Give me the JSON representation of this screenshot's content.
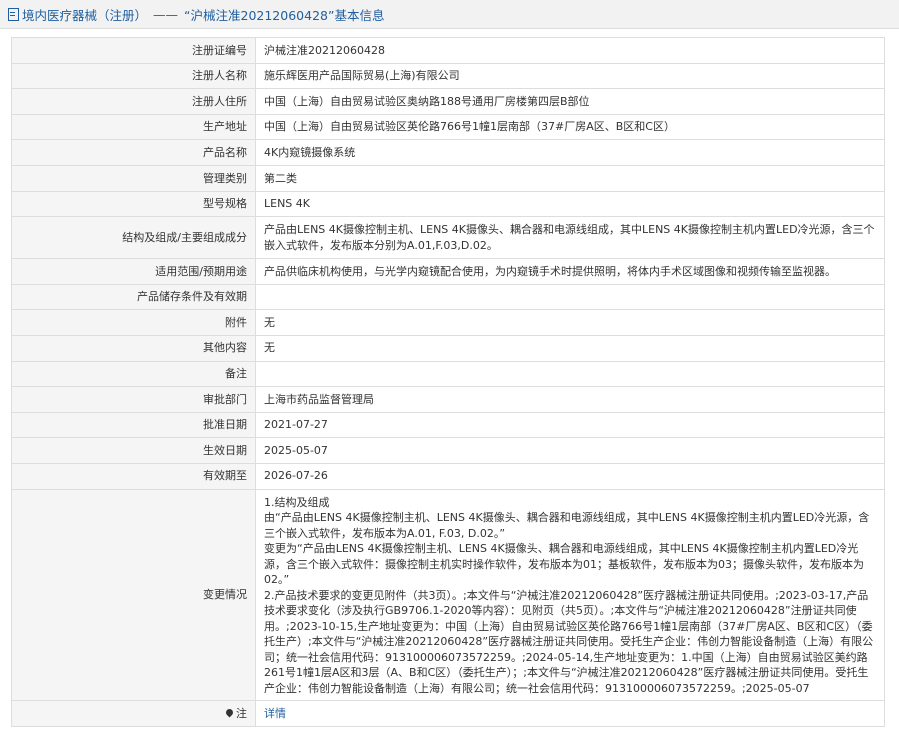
{
  "header": {
    "category": "境内医疗器械（注册）",
    "separator": "——",
    "title": "“沪械注准20212060428”基本信息"
  },
  "rows": [
    {
      "label": "注册证编号",
      "value": "沪械注准20212060428"
    },
    {
      "label": "注册人名称",
      "value": "施乐辉医用产品国际贸易(上海)有限公司"
    },
    {
      "label": "注册人住所",
      "value": "中国（上海）自由贸易试验区奥纳路188号通用厂房楼第四层B部位"
    },
    {
      "label": "生产地址",
      "value": "中国（上海）自由贸易试验区英伦路766号1幢1层南部（37#厂房A区、B区和C区）"
    },
    {
      "label": "产品名称",
      "value": "4K内窥镜摄像系统"
    },
    {
      "label": "管理类别",
      "value": "第二类"
    },
    {
      "label": "型号规格",
      "value": "LENS 4K"
    },
    {
      "label": "结构及组成/主要组成成分",
      "value": "产品由LENS 4K摄像控制主机、LENS 4K摄像头、耦合器和电源线组成，其中LENS 4K摄像控制主机内置LED冷光源，含三个嵌入式软件，发布版本分别为A.01,F.03,D.02。"
    },
    {
      "label": "适用范围/预期用途",
      "value": "产品供临床机构使用，与光学内窥镜配合使用，为内窥镜手术时提供照明，将体内手术区域图像和视频传输至监视器。"
    },
    {
      "label": "产品储存条件及有效期",
      "value": ""
    },
    {
      "label": "附件",
      "value": "无"
    },
    {
      "label": "其他内容",
      "value": "无"
    },
    {
      "label": "备注",
      "value": ""
    },
    {
      "label": "审批部门",
      "value": "上海市药品监督管理局"
    },
    {
      "label": "批准日期",
      "value": "2021-07-27"
    },
    {
      "label": "生效日期",
      "value": "2025-05-07"
    },
    {
      "label": "有效期至",
      "value": "2026-07-26"
    }
  ],
  "changes": {
    "label": "变更情况",
    "lines": [
      "1.结构及组成",
      "由“产品由LENS 4K摄像控制主机、LENS 4K摄像头、耦合器和电源线组成，其中LENS 4K摄像控制主机内置LED冷光源，含三个嵌入式软件，发布版本为A.01, F.03, D.02。”",
      "变更为“产品由LENS 4K摄像控制主机、LENS 4K摄像头、耦合器和电源线组成，其中LENS 4K摄像控制主机内置LED冷光源，含三个嵌入式软件：摄像控制主机实时操作软件，发布版本为01；基板软件，发布版本为03；摄像头软件，发布版本为02。”",
      "2.产品技术要求的变更见附件（共3页）。;本文件与“沪械注准20212060428”医疗器械注册证共同使用。;2023-03-17,产品技术要求变化（涉及执行GB9706.1-2020等内容）：见附页（共5页）。;本文件与“沪械注准20212060428”注册证共同使用。;2023-10-15,生产地址变更为：中国（上海）自由贸易试验区英伦路766号1幢1层南部（37#厂房A区、B区和C区）（委托生产）;本文件与“沪械注准20212060428”医疗器械注册证共同使用。受托生产企业：伟创力智能设备制造（上海）有限公司；统一社会信用代码：913100006073572259。;2024-05-14,生产地址变更为：1.中国（上海）自由贸易试验区美约路261号1幢1层A区和3层（A、B和C区）（委托生产）；;本文件与“沪械注准20212060428”医疗器械注册证共同使用。受托生产企业：伟创力智能设备制造（上海）有限公司；统一社会信用代码：913100006073572259。;2025-05-07"
    ]
  },
  "note": {
    "label": "注",
    "link_text": "详情"
  }
}
